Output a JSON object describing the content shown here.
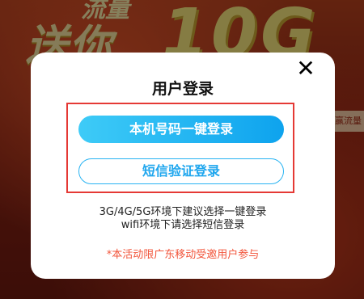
{
  "background": {
    "promo_text_left": "送你",
    "promo_text_big": "10G",
    "promo_top_strip": "流量",
    "side_tag": "赢流量"
  },
  "dialog": {
    "close_symbol": "✕",
    "title": "用户登录",
    "primary_button_label": "本机号码一键登录",
    "secondary_button_label": "短信验证登录",
    "hint_line_1": "3G/4G/5G环境下建议选择一键登录",
    "hint_line_2": "wifi环境下请选择短信登录",
    "notice": "*本活动限广东移动受邀用户参与"
  },
  "colors": {
    "primary_button": "#0ea3ee",
    "highlight_border": "#e53935",
    "notice_text": "#f2553b"
  },
  "icons": {
    "close": "close-icon"
  }
}
